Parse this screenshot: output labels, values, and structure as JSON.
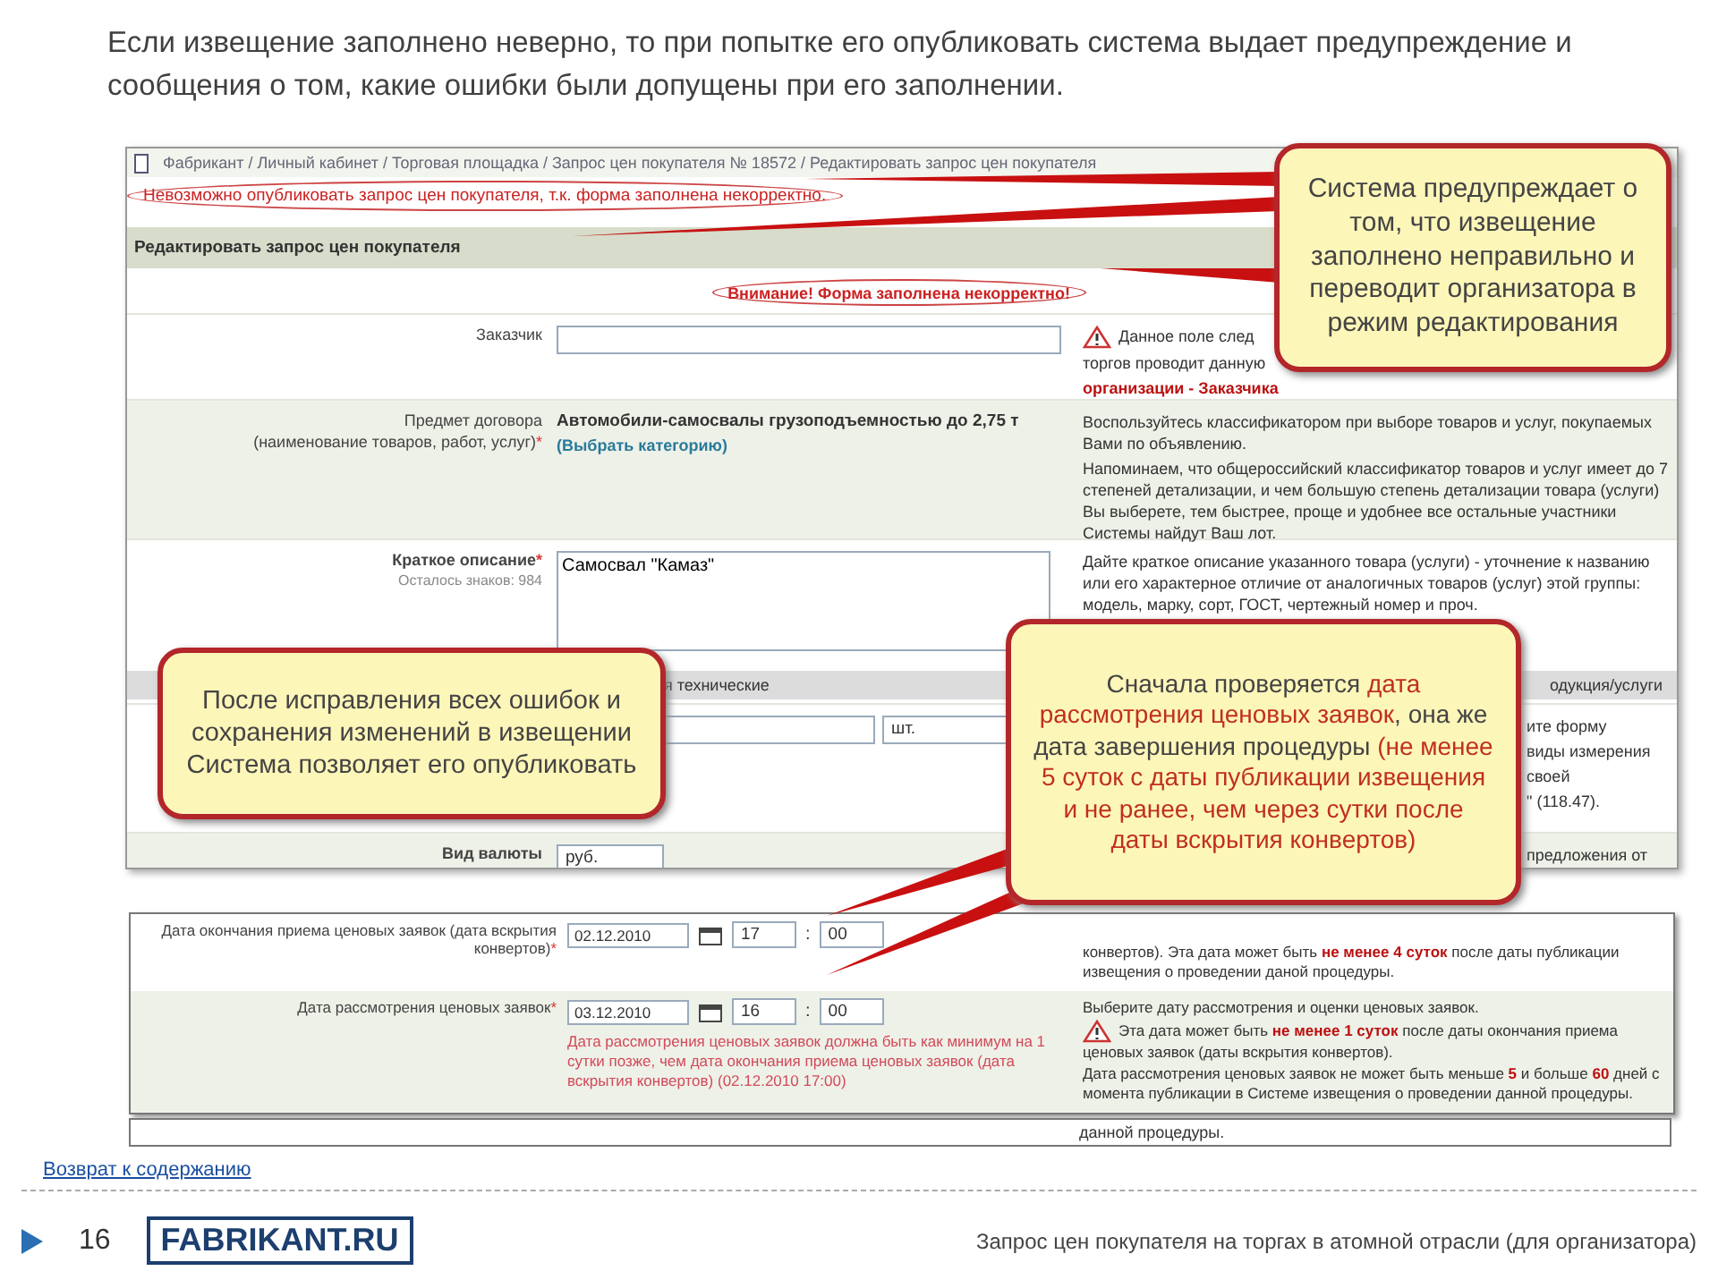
{
  "title": "Если извещение заполнено неверно, то при попытке его опубликовать система выдает предупреждение и сообщения о том, какие ошибки были допущены при его заполнении.",
  "form": {
    "breadcrumb": "Фабрикант / Личный кабинет / Торговая площадка / Запрос цен покупателя № 18572 / Редактировать запрос цен покупателя",
    "error": "Невозможно опубликовать запрос цен покупателя, т.к. форма заполнена некорректно.",
    "header": "Редактировать запрос цен покупателя",
    "warning": "Внимание! Форма заполнена некорректно!",
    "rows": [
      {
        "kind": "input",
        "label": "Заказчик",
        "value": "",
        "help": [
          "Данное поле след",
          "торгов проводит данную",
          "**организации - Заказчика**"
        ],
        "help_warning": true
      },
      {
        "kind": "subject",
        "label": "Предмет договора",
        "label2": "(наименование товаров, работ, услуг)",
        "required_mark": "*",
        "value": "Автомобили-самосвалы грузоподъемностью до 2,75 т",
        "link": "(Выбрать категорию)",
        "help": [
          "Воспользуйтесь классификатором при выборе товаров и услуг, покупаемых Вами по объявлению.",
          "Напоминаем, что общероссийский классификатор товаров и услуг имеет до 7 степеней детализации, и чем большую степень детализации товара (услуги) Вы выберете, тем быстрее, проще и удобнее все остальные участники Системы найдут Ваш лот."
        ]
      },
      {
        "kind": "textarea",
        "label": "Краткое описание",
        "label2": "Осталось знаков: 984",
        "required_mark": "*",
        "value": "Самосвал \"Камаз\"",
        "help": [
          "Дайте краткое описание указанного товара (услуги) - уточнение к названию или его характерное отличие от аналогичных товаров (услуг) этой группы: модель, марку, сорт, ГОСТ, чертежный номер и проч."
        ]
      },
      {
        "kind": "bar",
        "label": "я технические",
        "help": [
          "одукция/услуги"
        ]
      },
      {
        "kind": "quantity",
        "value": "",
        "unit": "шт.",
        "help": [
          "ите форму",
          "виды измерения",
          "своей",
          "\" (118.47)."
        ]
      },
      {
        "kind": "currency",
        "label": "Вид валюты",
        "value": "руб.",
        "help": [
          "предложения от"
        ]
      }
    ]
  },
  "dates": {
    "rows": [
      {
        "label": "Дата окончания приема ценовых заявок (дата вскрытия конвертов)",
        "required_mark": "*",
        "date": "02.12.2010",
        "hour": "17",
        "separator": ":",
        "minute": "00",
        "help": [
          "конвертов). Эта дата может быть **не менее 4 суток** после даты публикации извещения о проведении даной процедуры."
        ]
      },
      {
        "label": "Дата рассмотрения ценовых заявок",
        "required_mark": "*",
        "date": "03.12.2010",
        "hour": "16",
        "separator": ":",
        "minute": "00",
        "error": "Дата рассмотрения ценовых заявок должна быть как минимум на 1 сутки позже, чем дата окончания приема ценовых заявок (дата вскрытия конвертов) (02.12.2010 17:00)",
        "help": [
          "Выберите дату рассмотрения и оценки ценовых заявок.",
          "Эта дата может быть **не менее 1 суток** после даты окончания приема ценовых заявок (даты вскрытия конвертов).",
          "Дата рассмотрения ценовых заявок не может быть меньше **5** и больше **60** дней с момента публикации в Системе извещения о проведении данной процедуры."
        ],
        "help_warning": true
      }
    ],
    "tail": "данной процедуры."
  },
  "callouts": [
    {
      "segments": [
        {
          "text": "Система предупреждает о том, что извещение заполнено неправильно и переводит организатора в режим редактирования",
          "highlight": false
        }
      ]
    },
    {
      "segments": [
        {
          "text": "После исправления всех ошибок и сохранения изменений в извещении Система позволяет его опубликовать",
          "highlight": false
        }
      ]
    },
    {
      "segments": [
        {
          "text": "Сначала проверяется ",
          "highlight": false
        },
        {
          "text": "дата рассмотрения ценовых заявок",
          "highlight": true
        },
        {
          "text": ", она же дата завершения процедуры ",
          "highlight": false
        },
        {
          "text": "(не менее 5 суток с даты публикации извещения и не ранее, чем через сутки после даты вскрытия конвертов)",
          "highlight": true
        }
      ]
    }
  ],
  "footer": {
    "link": "Возврат к содержанию",
    "page": "16",
    "logo": "FABRIKANT.RU",
    "caption": "Запрос цен покупателя на торгах в атомной отрасли (для организатора)"
  }
}
